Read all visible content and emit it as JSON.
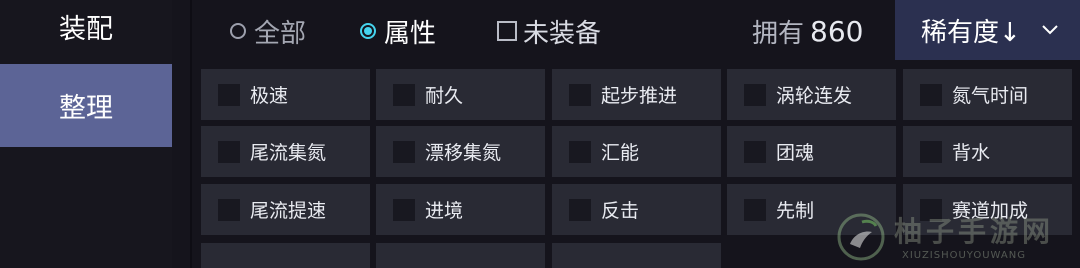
{
  "sidebar": {
    "items": [
      {
        "label": "装配"
      },
      {
        "label": "整理"
      }
    ]
  },
  "filters": {
    "radio_all": "全部",
    "radio_attribute": "属性",
    "unequipped_label": "未装备"
  },
  "owned": {
    "label": "拥有",
    "count": "860"
  },
  "sort": {
    "label": "稀有度↓"
  },
  "attributes": [
    [
      "极速",
      "耐久",
      "起步推进",
      "涡轮连发",
      "氮气时间"
    ],
    [
      "尾流集氮",
      "漂移集氮",
      "汇能",
      "团魂",
      "背水"
    ],
    [
      "尾流提速",
      "进境",
      "反击",
      "先制",
      "赛道加成"
    ]
  ],
  "watermark": {
    "text": "柚子手游网",
    "subtext": "XIUZISHOUYOUWANG"
  },
  "colors": {
    "selected_sidebar": "#5c6496",
    "sort_bg": "#2b3050",
    "radio_accent": "#45d4ee",
    "cell_bg": "#292a34"
  }
}
